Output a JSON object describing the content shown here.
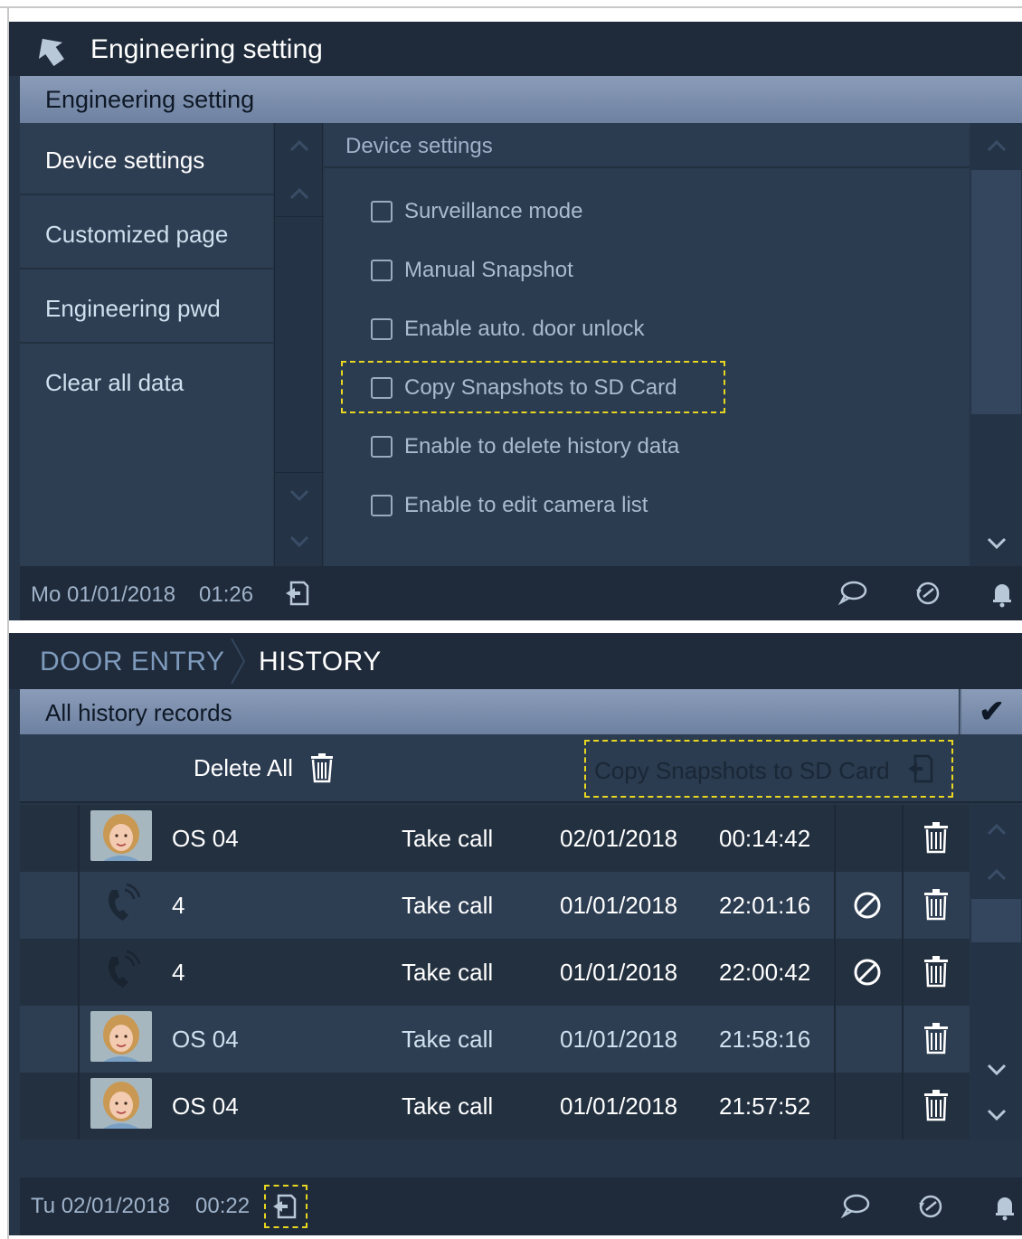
{
  "panel1": {
    "header_title": "Engineering setting",
    "sub_title": "Engineering setting",
    "nav_items": [
      {
        "label": "Device settings"
      },
      {
        "label": "Customized page"
      },
      {
        "label": "Engineering pwd"
      },
      {
        "label": "Clear all data"
      }
    ],
    "content_title": "Device settings",
    "options": [
      {
        "label": "Surveillance mode",
        "checked": false
      },
      {
        "label": "Manual Snapshot",
        "checked": false
      },
      {
        "label": "Enable auto. door unlock",
        "checked": false
      },
      {
        "label": "Copy Snapshots to SD Card",
        "checked": false
      },
      {
        "label": "Enable to delete history data",
        "checked": false
      },
      {
        "label": "Enable to edit camera list",
        "checked": false
      }
    ],
    "status": {
      "date": "Mo 01/01/2018",
      "time": "01:26"
    }
  },
  "panel2": {
    "breadcrumb": "DOOR ENTRY",
    "current": "HISTORY",
    "sub_title": "All history records",
    "confirm_label": "✔",
    "delete_all_label": "Delete All",
    "copy_sd_label": "Copy Snapshots to SD Card",
    "rows": [
      {
        "name": "OS 04",
        "type": "Take call",
        "date": "02/01/2018",
        "time": "00:14:42",
        "kind": "snapshot",
        "blocked": false
      },
      {
        "name": "4",
        "type": "Take call",
        "date": "01/01/2018",
        "time": "22:01:16",
        "kind": "audio",
        "blocked": true
      },
      {
        "name": "4",
        "type": "Take call",
        "date": "01/01/2018",
        "time": "22:00:42",
        "kind": "audio",
        "blocked": true
      },
      {
        "name": "OS 04",
        "type": "Take call",
        "date": "01/01/2018",
        "time": "21:58:16",
        "kind": "snapshot",
        "blocked": false
      },
      {
        "name": "OS 04",
        "type": "Take call",
        "date": "01/01/2018",
        "time": "21:57:52",
        "kind": "snapshot",
        "blocked": false
      }
    ],
    "status": {
      "date": "Tu 02/01/2018",
      "time": "00:22"
    }
  },
  "colors": {
    "panel_bg": "#263548",
    "header_bg": "#1f2b3a",
    "highlight": "#e8d620",
    "subbar": "#7e91ae"
  },
  "icons": [
    "back-arrow-icon",
    "chevron-up-icon",
    "chevron-down-icon",
    "sd-card-icon",
    "message-icon",
    "history-icon",
    "bell-icon",
    "trash-icon",
    "block-icon",
    "phone-icon",
    "checkmark-icon"
  ]
}
